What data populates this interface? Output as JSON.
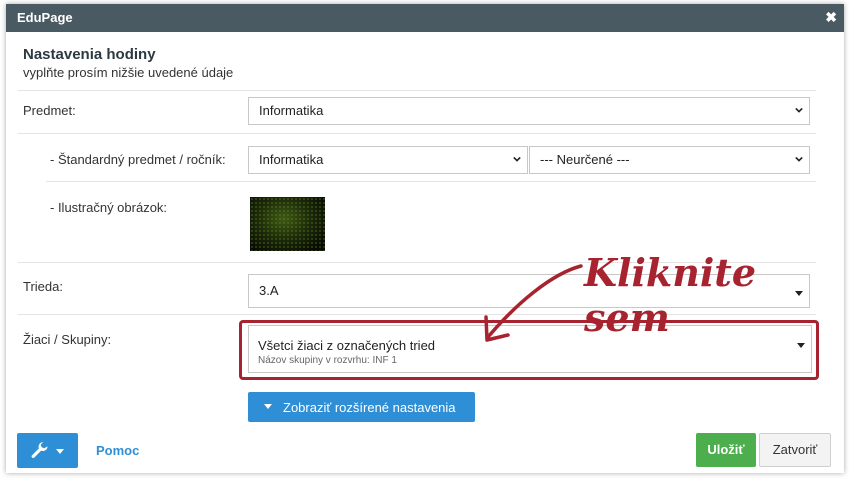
{
  "window": {
    "title": "EduPage"
  },
  "header": {
    "title": "Nastavenia hodiny",
    "subtitle": "vyplňte prosím nižšie uvedené údaje"
  },
  "fields": {
    "subject": {
      "label": "Predmet:",
      "value": "Informatika"
    },
    "standard": {
      "label": "- Štandardný predmet / ročník:",
      "subject_value": "Informatika",
      "grade_value": "--- Neurčené ---"
    },
    "image": {
      "label": "- Ilustračný obrázok:"
    },
    "class": {
      "label": "Trieda:",
      "value": "3.A"
    },
    "students": {
      "label": "Žiaci / Skupiny:",
      "value": "Všetci žiaci z označených tried",
      "sub": "Názov skupiny v rozvrhu: INF 1"
    }
  },
  "annotation": {
    "text": "Kliknite sem",
    "color": "#a6232f"
  },
  "buttons": {
    "advanced": "Zobraziť rozšírené nastavenia",
    "help": "Pomoc",
    "save": "Uložiť",
    "close": "Zatvoriť"
  },
  "colors": {
    "titlebar": "#4a5a63",
    "primary": "#2f8fd6",
    "success": "#4cae4c"
  }
}
